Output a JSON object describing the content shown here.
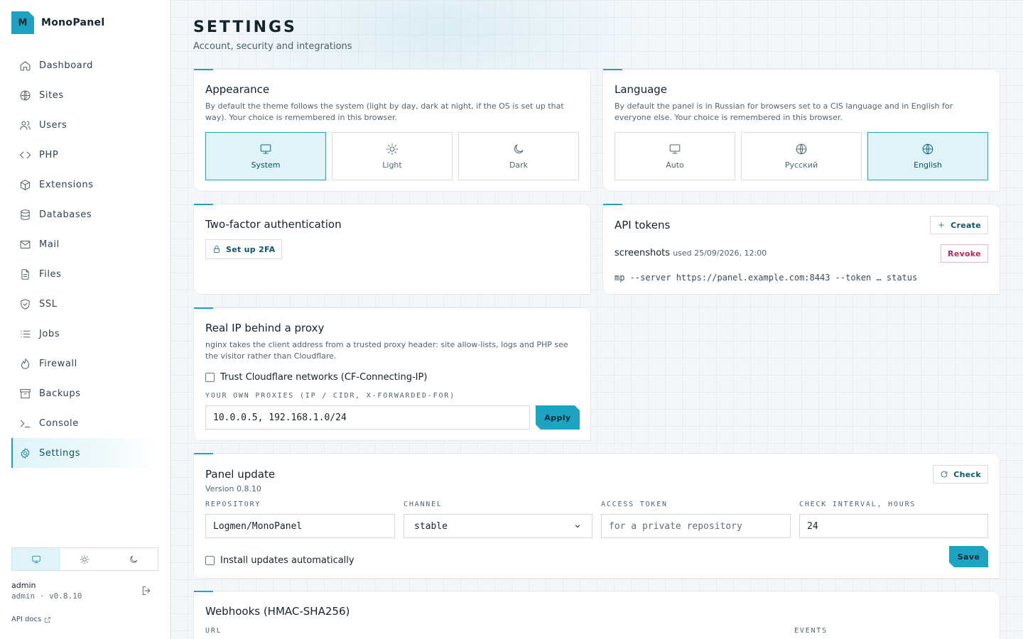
{
  "brand": {
    "logo_letter": "M",
    "name": "MonoPanel"
  },
  "nav": [
    {
      "label": "Dashboard",
      "icon": "home-icon"
    },
    {
      "label": "Sites",
      "icon": "globe-icon"
    },
    {
      "label": "Users",
      "icon": "users-icon"
    },
    {
      "label": "PHP",
      "icon": "code-icon"
    },
    {
      "label": "Extensions",
      "icon": "box-icon"
    },
    {
      "label": "Databases",
      "icon": "database-icon"
    },
    {
      "label": "Mail",
      "icon": "mail-icon"
    },
    {
      "label": "Files",
      "icon": "file-icon"
    },
    {
      "label": "SSL",
      "icon": "shield-icon"
    },
    {
      "label": "Jobs",
      "icon": "list-icon"
    },
    {
      "label": "Firewall",
      "icon": "flame-icon"
    },
    {
      "label": "Backups",
      "icon": "archive-icon"
    },
    {
      "label": "Console",
      "icon": "terminal-icon"
    },
    {
      "label": "Settings",
      "icon": "gear-icon",
      "active": true
    }
  ],
  "theme_switch": {
    "selected": "system"
  },
  "user": {
    "name": "admin",
    "meta": "admin · v0.8.10"
  },
  "api_docs": "API docs",
  "page": {
    "title": "SETTINGS",
    "subtitle": "Account, security and integrations"
  },
  "appearance": {
    "title": "Appearance",
    "desc": "By default the theme follows the system (light by day, dark at night, if the OS is set up that way). Your choice is remembered in this browser.",
    "options": [
      "System",
      "Light",
      "Dark"
    ],
    "selected": "System"
  },
  "language": {
    "title": "Language",
    "desc": "By default the panel is in Russian for browsers set to a CIS language and in English for everyone else. Your choice is remembered in this browser.",
    "options": [
      "Auto",
      "Русский",
      "English"
    ],
    "selected": "English"
  },
  "twofa": {
    "title": "Two-factor authentication",
    "button": "Set up 2FA"
  },
  "api_tokens": {
    "title": "API tokens",
    "create": "Create",
    "token_name": "screenshots",
    "token_used": "used 25/09/2026, 12:00",
    "revoke": "Revoke",
    "command": "mp --server https://panel.example.com:8443 --token … status"
  },
  "real_ip": {
    "title": "Real IP behind a proxy",
    "desc": "nginx takes the client address from a trusted proxy header: site allow-lists, logs and PHP see the visitor rather than Cloudflare.",
    "checkbox": "Trust Cloudflare networks (CF-Connecting-IP)",
    "proxies_label": "YOUR OWN PROXIES (IP / CIDR, X-FORWARDED-FOR)",
    "proxies_value": "10.0.0.5, 192.168.1.0/24",
    "apply": "Apply"
  },
  "panel_update": {
    "title": "Panel update",
    "version": "Version 0.8.10",
    "check": "Check",
    "repo_label": "REPOSITORY",
    "repo_value": "Logmen/MonoPanel",
    "channel_label": "CHANNEL",
    "channel_value": "stable",
    "token_label": "ACCESS TOKEN",
    "token_placeholder": "for a private repository",
    "interval_label": "CHECK INTERVAL, HOURS",
    "interval_value": "24",
    "auto_label": "Install updates automatically",
    "save": "Save"
  },
  "webhooks": {
    "title": "Webhooks (HMAC-SHA256)",
    "url_label": "URL",
    "events_label": "EVENTS"
  },
  "colors": {
    "accent": "#1ea3c3",
    "danger": "#c0245c"
  }
}
